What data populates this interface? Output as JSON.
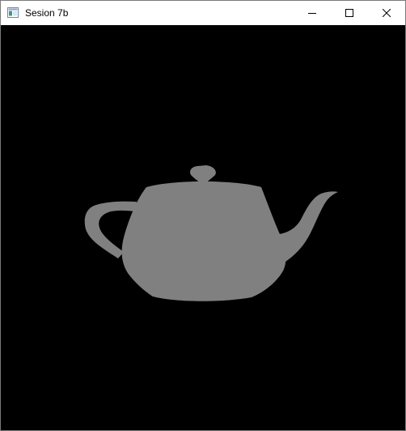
{
  "window": {
    "title": "Sesion 7b"
  },
  "titlebar": {
    "icon": "app-window-icon",
    "minimize_icon": "minimize-icon",
    "maximize_icon": "maximize-icon",
    "close_icon": "close-icon"
  },
  "viewport": {
    "background_color": "#000000",
    "object": "teapot",
    "object_color": "#808080"
  }
}
